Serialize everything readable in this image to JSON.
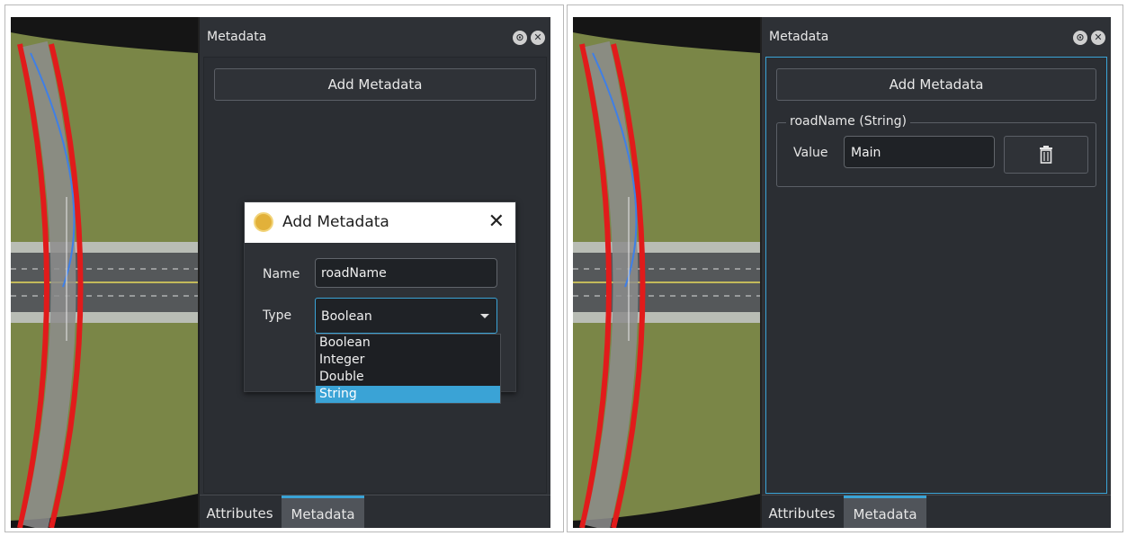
{
  "colors": {
    "accent": "#3aa3d6",
    "panel": "#2e3136",
    "terrain": "#7a8647",
    "road_border": "#e11b1b",
    "lane_line": "#3f7fe6"
  },
  "left": {
    "panel_title": "Metadata",
    "add_button": "Add Metadata",
    "tabs": [
      "Attributes",
      "Metadata"
    ],
    "dialog": {
      "title": "Add Metadata",
      "close_icon": "close-icon",
      "name_label": "Name",
      "name_value": "roadName",
      "type_label": "Type",
      "type_value": "Boolean",
      "options": [
        "Boolean",
        "Integer",
        "Double",
        "String"
      ],
      "highlighted_option": "String"
    }
  },
  "right": {
    "panel_title": "Metadata",
    "add_button": "Add Metadata",
    "group_title": "roadName (String)",
    "value_label": "Value",
    "value": "Main",
    "delete_icon": "trash-icon",
    "tabs": [
      "Attributes",
      "Metadata"
    ]
  }
}
